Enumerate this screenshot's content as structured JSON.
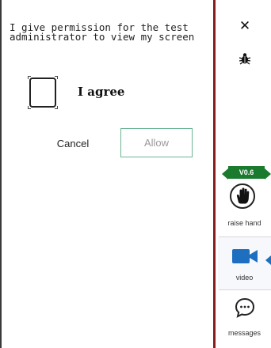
{
  "permission_dialog": {
    "message": "I give permission for the test administrator to view my screen",
    "agree_label": "I agree",
    "cancel_label": "Cancel",
    "allow_label": "Allow"
  },
  "toolbar": {
    "close_symbol": "✕",
    "version": "V0.6",
    "items": [
      {
        "label": "raise hand",
        "icon": "raise-hand-icon"
      },
      {
        "label": "video",
        "icon": "video-camera-icon"
      },
      {
        "label": "messages",
        "icon": "messages-icon"
      }
    ]
  },
  "colors": {
    "accent_red": "#8b1c1c",
    "allow_border": "#6db493",
    "video_blue": "#1e6fbf",
    "version_green": "#1a7a2e"
  }
}
